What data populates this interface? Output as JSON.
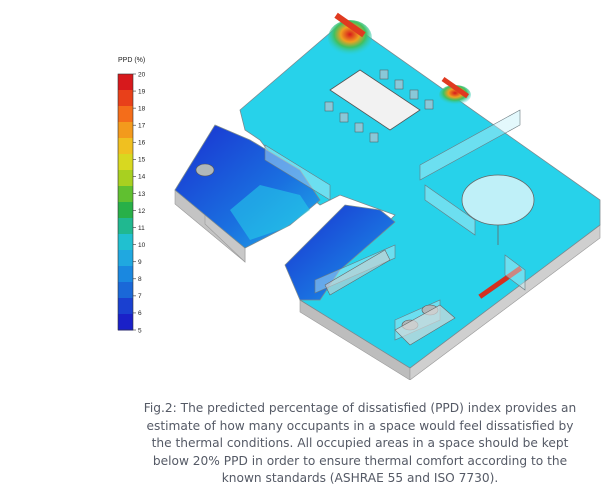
{
  "legend": {
    "title": "PPD (%)",
    "ticks": [
      "20",
      "19",
      "18",
      "17",
      "16",
      "15",
      "14",
      "13",
      "12",
      "11",
      "10",
      "9",
      "8",
      "7",
      "6",
      "5"
    ],
    "colors": [
      "#d7191c",
      "#e8401a",
      "#f46d1a",
      "#f39a1c",
      "#f0c020",
      "#d8d820",
      "#a8d020",
      "#60c030",
      "#28b048",
      "#20b890",
      "#20c0d0",
      "#20a8e0",
      "#1a88e0",
      "#1a68d8",
      "#1a40d0",
      "#1a20c8"
    ]
  },
  "model": {
    "floor_color": "#27d2ea",
    "wall_color": "#c8c8c8",
    "cold_color": "#1a55d8",
    "hot_color": "#e83020"
  },
  "caption": "Fig.2: The predicted percentage of dissatisfied (PPD) index provides an estimate of how many occupants in a space would feel dissatisfied by the thermal conditions. All occupied areas in a space should be kept below 20% PPD in order to ensure thermal comfort according to the known standards (ASHRAE 55 and ISO 7730)."
}
